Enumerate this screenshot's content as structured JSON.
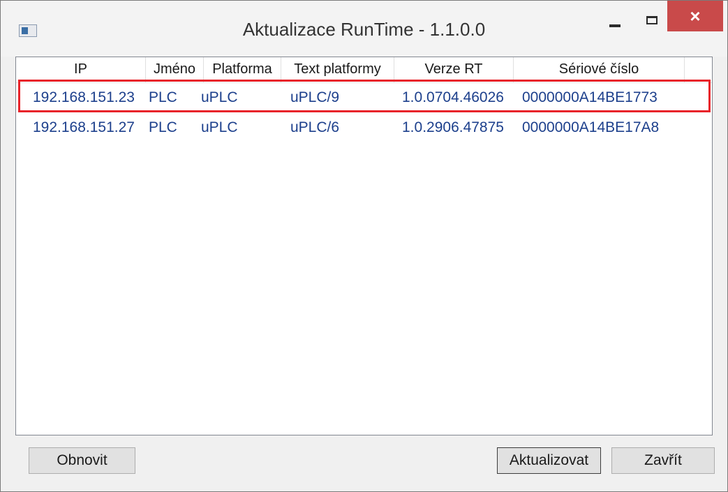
{
  "window": {
    "title": "Aktualizace RunTime - 1.1.0.0",
    "close_glyph": "×",
    "icons": {
      "app": "app-window-icon",
      "minimize": "minimize-icon",
      "maximize": "maximize-icon",
      "close": "close-icon"
    },
    "colors": {
      "close_button": "#c94a4a",
      "row_text": "#1c3f8c",
      "highlight_border": "#e8232a"
    }
  },
  "table": {
    "columns": [
      "IP",
      "Jméno",
      "Platforma",
      "Text platformy",
      "Verze RT",
      "Sériové číslo"
    ],
    "rows": [
      [
        "192.168.151.23",
        "PLC",
        "uPLC",
        "uPLC/9",
        "1.0.0704.46026",
        "0000000A14BE1773"
      ],
      [
        "192.168.151.27",
        "PLC",
        "uPLC",
        "uPLC/6",
        "1.0.2906.47875",
        "0000000A14BE17A8"
      ]
    ],
    "highlighted_row": 0
  },
  "buttons": {
    "refresh": "Obnovit",
    "update": "Aktualizovat",
    "close": "Zavřít"
  }
}
